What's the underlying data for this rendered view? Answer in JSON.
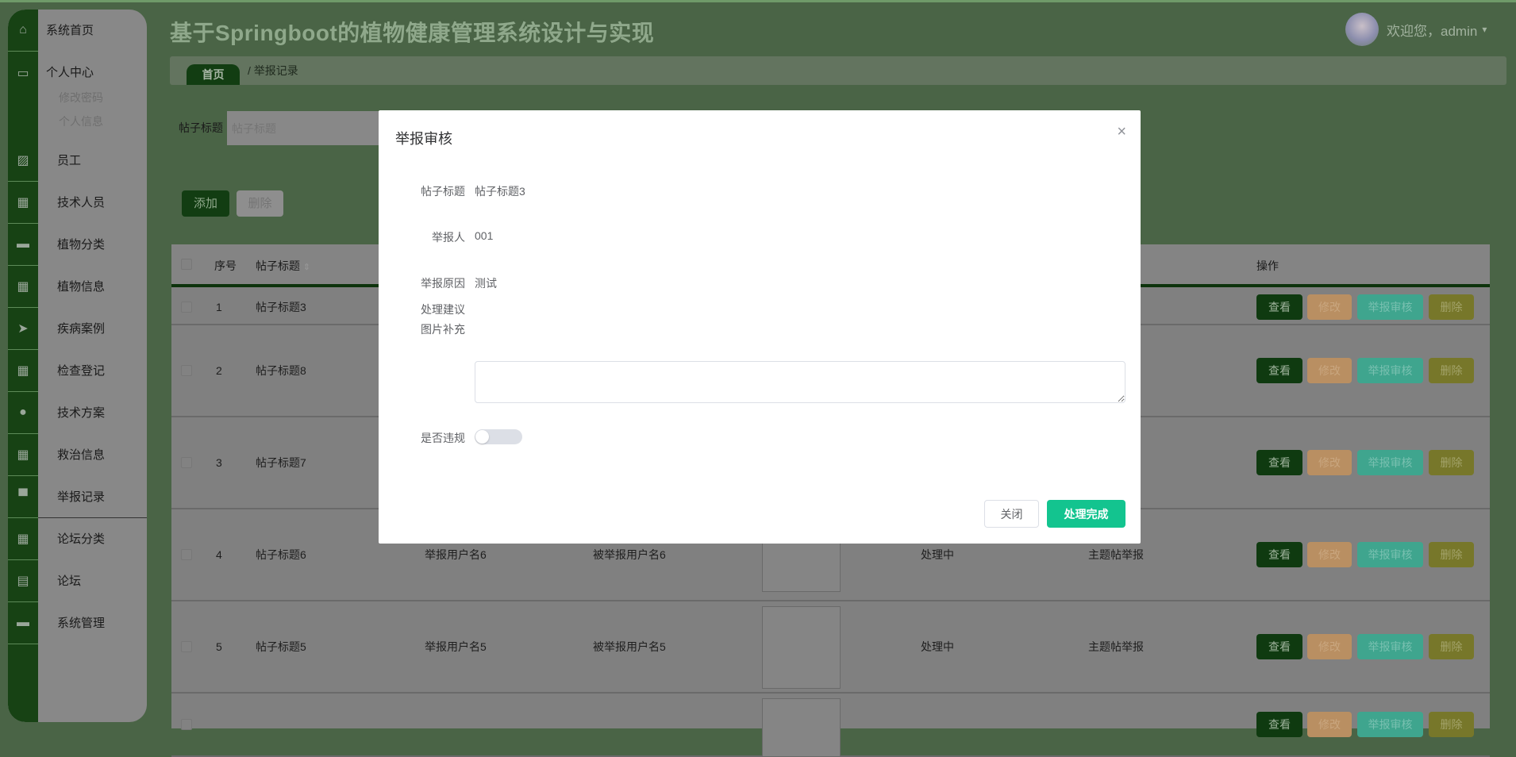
{
  "app_title": "基于Springboot的植物健康管理系统设计与实现",
  "user": {
    "greeting": "欢迎您，admin",
    "caret": "▾"
  },
  "sidebar": {
    "home": "系统首页",
    "personal": "个人中心",
    "personal_sub": [
      "修改密码",
      "个人信息"
    ],
    "items": [
      {
        "label": "员工",
        "icon": "chart-icon"
      },
      {
        "label": "技术人员",
        "icon": "grid-icon"
      },
      {
        "label": "植物分类",
        "icon": "ticket-icon"
      },
      {
        "label": "植物信息",
        "icon": "table-icon"
      },
      {
        "label": "疾病案例",
        "icon": "send-icon"
      },
      {
        "label": "检查登记",
        "icon": "grid-icon"
      },
      {
        "label": "技术方案",
        "icon": "bulb-icon"
      },
      {
        "label": "救治信息",
        "icon": "grid-icon"
      },
      {
        "label": "举报记录",
        "icon": "inbox-icon",
        "active": true
      },
      {
        "label": "论坛分类",
        "icon": "grid-icon"
      },
      {
        "label": "论坛",
        "icon": "clipboard-icon"
      },
      {
        "label": "系统管理",
        "icon": "briefcase-icon"
      }
    ]
  },
  "breadcrumb": {
    "home": "首页",
    "current": "/  举报记录"
  },
  "search": {
    "label": "帖子标题",
    "placeholder": "帖子标题"
  },
  "toolbar": {
    "add": "添加",
    "delete": "删除"
  },
  "table": {
    "headers": {
      "index": "序号",
      "title": "帖子标题",
      "actions": "操作"
    },
    "actions": [
      "查看",
      "修改",
      "举报审核",
      "删除"
    ],
    "rows": [
      {
        "index": "1",
        "title": "帖子标题3"
      },
      {
        "index": "2",
        "title": "帖子标题8"
      },
      {
        "index": "3",
        "title": "帖子标题7"
      },
      {
        "index": "4",
        "title": "帖子标题6",
        "reporter": "举报用户名6",
        "reported": "被举报用户名6",
        "status": "处理中",
        "type": "主题帖举报"
      },
      {
        "index": "5",
        "title": "帖子标题5",
        "reporter": "举报用户名5",
        "reported": "被举报用户名5",
        "status": "处理中",
        "type": "主题帖举报"
      },
      {
        "index": "",
        "title": ""
      }
    ]
  },
  "modal": {
    "title": "举报审核",
    "close_icon": "×",
    "fields": [
      {
        "label": "帖子标题",
        "value": "帖子标题3"
      },
      {
        "label": "举报人",
        "value": "001"
      },
      {
        "label": "举报原因",
        "value": "测试"
      },
      {
        "label": "图片补充",
        "value": ""
      }
    ],
    "suggestion_label": "处理建议",
    "suggestion_value": "",
    "violation_label": "是否违规",
    "violation_on": false,
    "close_button": "关闭",
    "submit_button": "处理完成"
  },
  "colors": {
    "primary": "#13c48f",
    "sidebar_icon_bg": "#174214"
  }
}
